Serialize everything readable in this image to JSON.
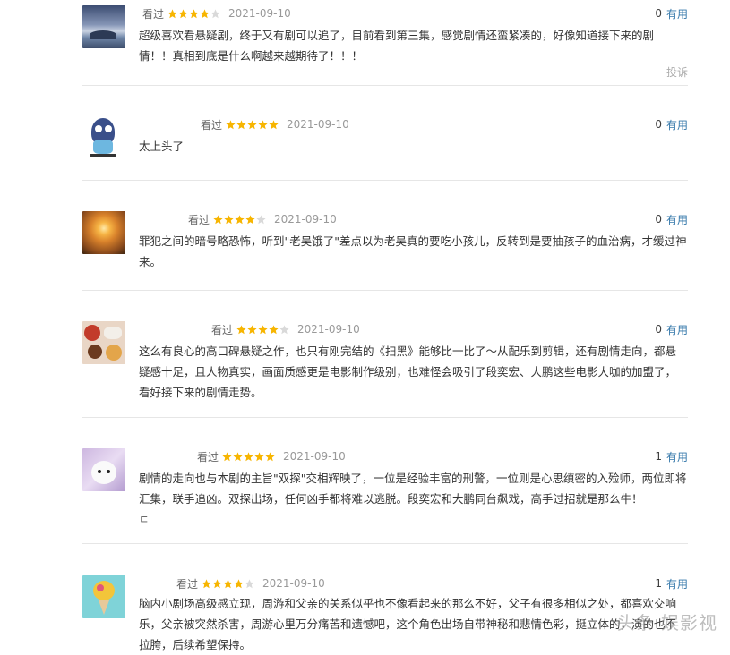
{
  "reviews": [
    {
      "user": "",
      "watched": "看过",
      "rating": 4,
      "date": "2021-09-10",
      "useful_count": "0",
      "useful_label": "有用",
      "text": "超级喜欢看悬疑剧，终于又有剧可以追了，目前看到第三集，感觉剧情还蛮紧凑的，好像知道接下来的剧情！！真相到底是什么啊越来越期待了！！！",
      "report": "投诉"
    },
    {
      "user": "",
      "watched": "看过",
      "rating": 5,
      "date": "2021-09-10",
      "useful_count": "0",
      "useful_label": "有用",
      "text": "太上头了"
    },
    {
      "user": "",
      "watched": "看过",
      "rating": 4,
      "date": "2021-09-10",
      "useful_count": "0",
      "useful_label": "有用",
      "text": "罪犯之间的暗号略恐怖，听到\"老吴饿了\"差点以为老吴真的要吃小孩儿，反转到是要抽孩子的血治病，才缓过神来。"
    },
    {
      "user": "",
      "watched": "看过",
      "rating": 4,
      "date": "2021-09-10",
      "useful_count": "0",
      "useful_label": "有用",
      "text": "这么有良心的高口碑悬疑之作，也只有刚完结的《扫黑》能够比一比了～从配乐到剪辑，还有剧情走向，都悬疑感十足，且人物真实，画面质感更是电影制作级别，也难怪会吸引了段奕宏、大鹏这些电影大咖的加盟了，看好接下来的剧情走势。"
    },
    {
      "user": "",
      "watched": "看过",
      "rating": 5,
      "date": "2021-09-10",
      "useful_count": "1",
      "useful_label": "有用",
      "text": "剧情的走向也与本剧的主旨\"双探\"交相辉映了，一位是经验丰富的刑警，一位则是心思缜密的入殓师，两位即将汇集，联手追凶。双探出场，任何凶手都将难以逃脱。段奕宏和大鹏同台飙戏，高手过招就是那么牛！",
      "extra": "ㄷ"
    },
    {
      "user": "",
      "watched": "看过",
      "rating": 4,
      "date": "2021-09-10",
      "useful_count": "1",
      "useful_label": "有用",
      "text": "脑内小剧场高级感立现，周游和父亲的关系似乎也不像看起来的那么不好，父子有很多相似之处，都喜欢交响乐，父亲被突然杀害，周游心里万分痛苦和遗憾吧，这个角色出场自带神秘和悲情色彩，挺立体的，演的也不拉胯，后续希望保持。"
    }
  ],
  "watermark": "头条 娱影视",
  "colors": {
    "star": "#f7b500",
    "star_empty": "#d9d9d9",
    "link": "#3377aa",
    "divider": "#e6e6e6"
  }
}
